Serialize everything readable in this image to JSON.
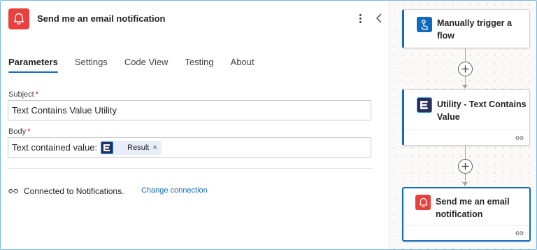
{
  "panel": {
    "title": "Send me an email notification",
    "header_icon": "bell-icon",
    "menu_icon": "more-vertical-icon",
    "collapse_icon": "chevron-left-icon",
    "tabs": [
      {
        "label": "Parameters",
        "active": true
      },
      {
        "label": "Settings",
        "active": false
      },
      {
        "label": "Code View",
        "active": false
      },
      {
        "label": "Testing",
        "active": false
      },
      {
        "label": "About",
        "active": false
      }
    ],
    "fields": {
      "subject": {
        "label": "Subject",
        "required_mark": "*",
        "value": "Text Contains Value Utility"
      },
      "body": {
        "label": "Body",
        "required_mark": "*",
        "value_prefix": "Text contained value:",
        "token": {
          "label": "Result",
          "remove": "×",
          "icon": "utility-icon"
        }
      }
    },
    "connection": {
      "icon": "link-icon",
      "text": "Connected to Notifications.",
      "change_label": "Change connection"
    }
  },
  "canvas": {
    "cards": [
      {
        "title": "Manually trigger a flow",
        "icon": "touch-icon",
        "icon_color": "#0f6cbd"
      },
      {
        "title": "Utility - Text Contains Value",
        "icon": "utility-icon",
        "icon_color": "#2a2f5b"
      },
      {
        "title": "Send me an email notification",
        "icon": "bell-icon",
        "icon_color": "#e8403d"
      }
    ],
    "add_icon": "plus-circle-icon"
  },
  "colors": {
    "accent": "#0f6cbd",
    "notification_red": "#e8403d",
    "token_bg": "#e7eef9",
    "link": "#0f6cbd"
  }
}
